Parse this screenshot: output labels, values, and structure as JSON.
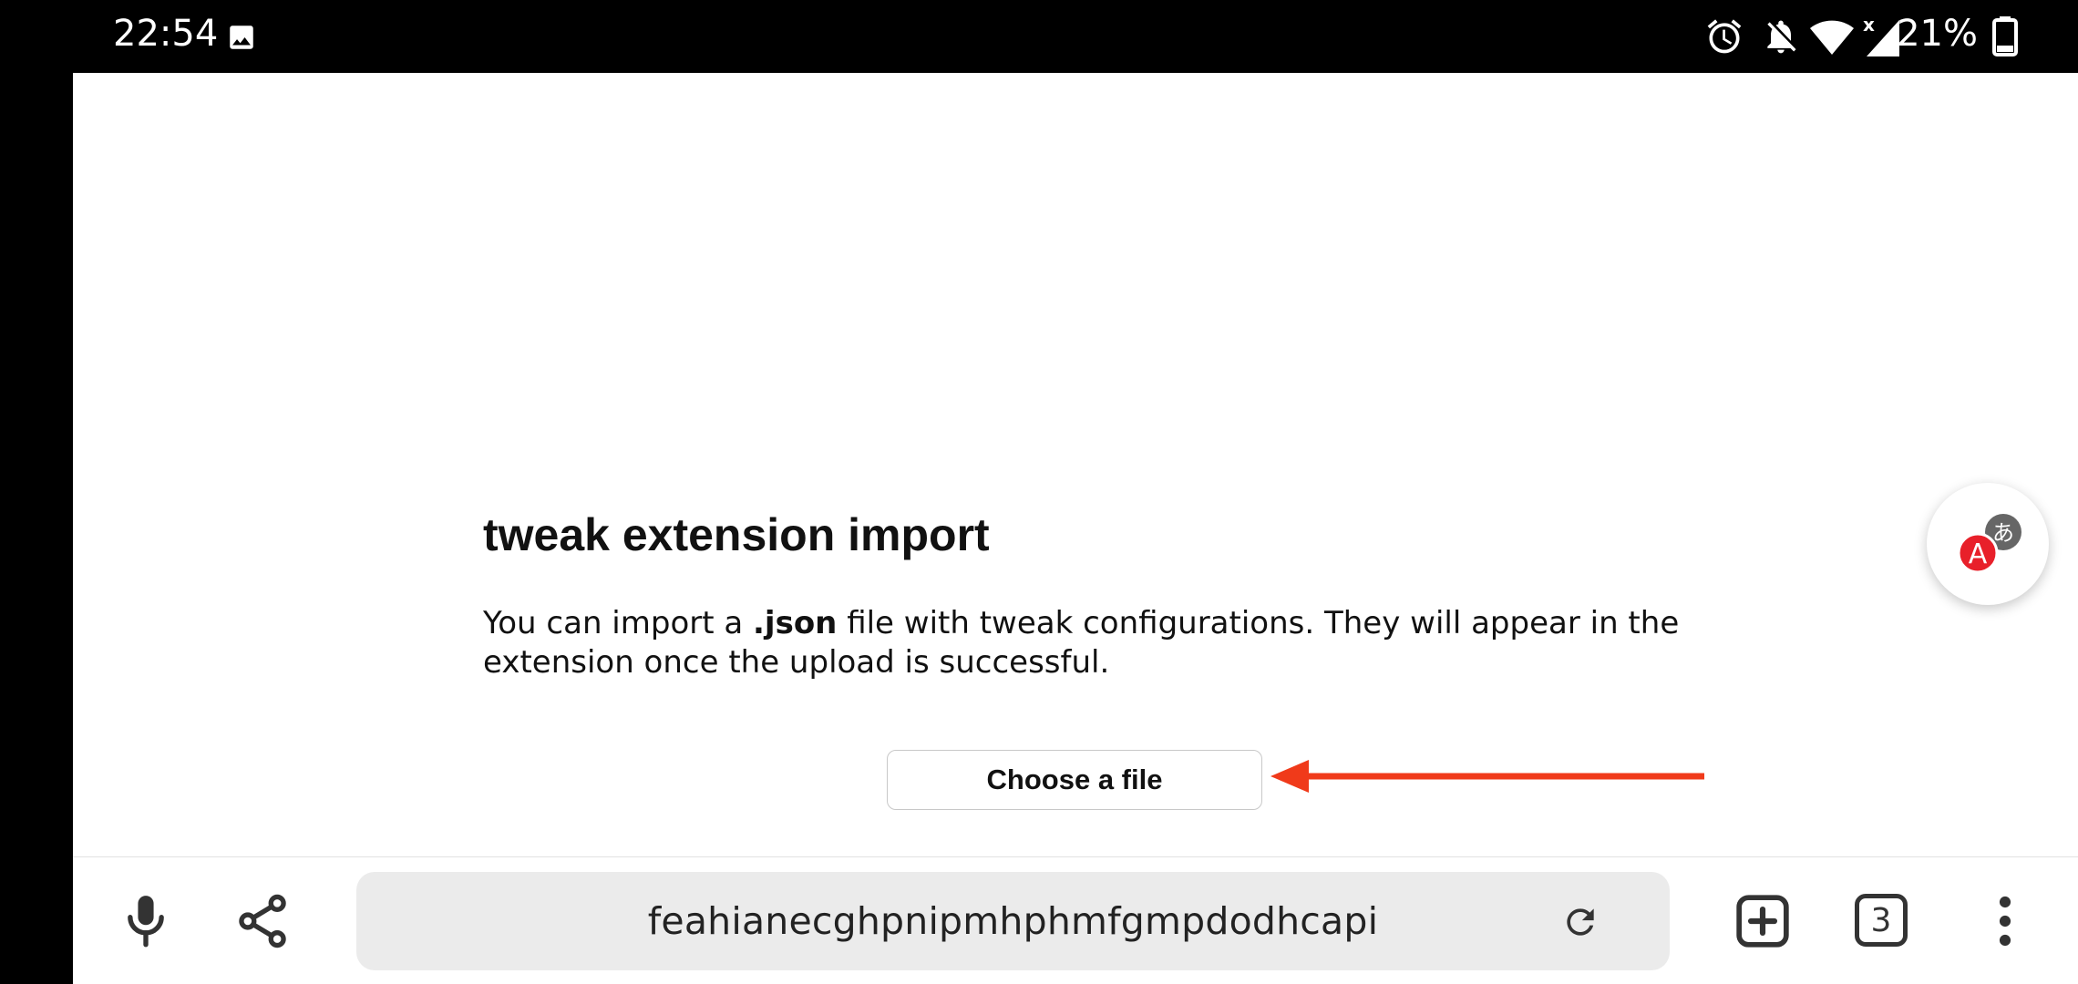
{
  "status_bar": {
    "time": "22:54",
    "battery": "21%",
    "icons": [
      "image-icon",
      "alarm-icon",
      "notifications-off-icon",
      "wifi-icon",
      "signal-icon",
      "battery-icon"
    ]
  },
  "page": {
    "title": "tweak extension import",
    "description_before": "You can import a ",
    "description_bold": ".json",
    "description_after": " file with tweak configurations. They will appear in the extension once the upload is successful.",
    "choose_file_label": "Choose a file",
    "arrow_color": "#f03a1a"
  },
  "translate_fab": {
    "icon": "translate-icon",
    "badge_letter": "A",
    "badge_color": "#e8202a",
    "glyph": "あ"
  },
  "toolbar": {
    "url": "feahianecghpnipmhphmfgmpdodhcapi",
    "tab_count": "3",
    "icons": [
      "microphone-icon",
      "share-icon",
      "reload-icon",
      "new-tab-icon",
      "tab-count-icon",
      "more-vert-icon"
    ]
  }
}
